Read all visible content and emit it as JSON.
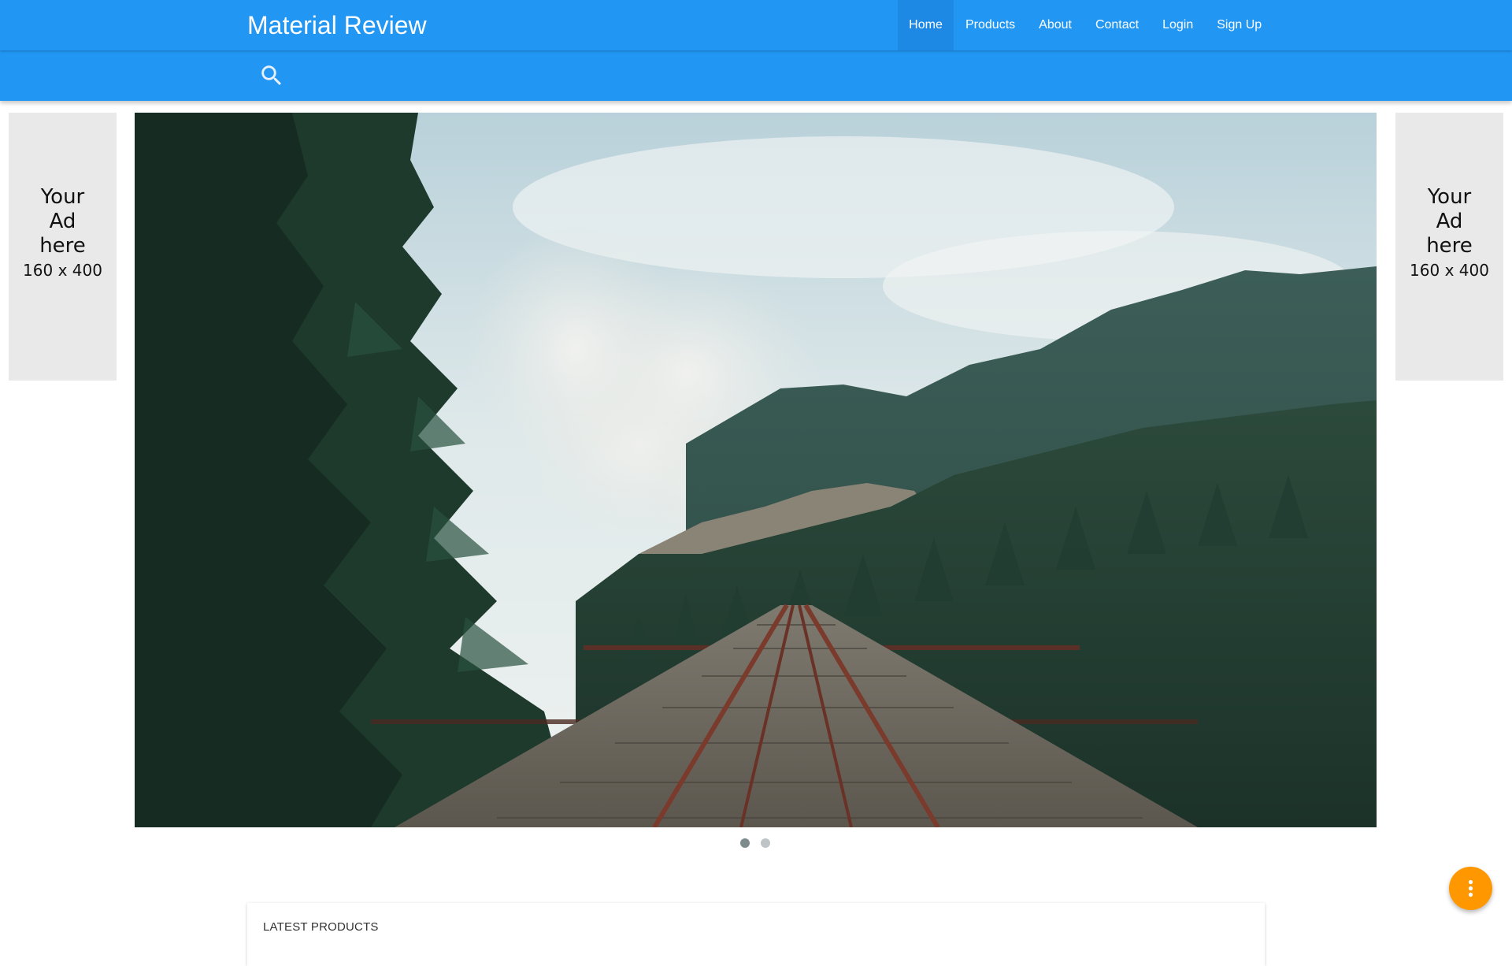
{
  "header": {
    "brand": "Material Review",
    "nav": [
      {
        "label": "Home",
        "active": true
      },
      {
        "label": "Products",
        "active": false
      },
      {
        "label": "About",
        "active": false
      },
      {
        "label": "Contact",
        "active": false
      },
      {
        "label": "Login",
        "active": false
      },
      {
        "label": "Sign Up",
        "active": false
      }
    ]
  },
  "search": {
    "icon": "search-icon"
  },
  "ads": {
    "left": {
      "text": "Your Ad here",
      "size": "160 x 400"
    },
    "right": {
      "text": "Your Ad here",
      "size": "160 x 400"
    }
  },
  "carousel": {
    "slide_count": 2,
    "active_index": 0
  },
  "products": {
    "title": "LATEST PRODUCTS"
  },
  "fab": {
    "icon": "more-vertical-icon"
  },
  "colors": {
    "primary": "#2196F3",
    "primary_dark": "#1E88E5",
    "accent": "#FF9800",
    "ad_background": "#e9e9e9"
  }
}
